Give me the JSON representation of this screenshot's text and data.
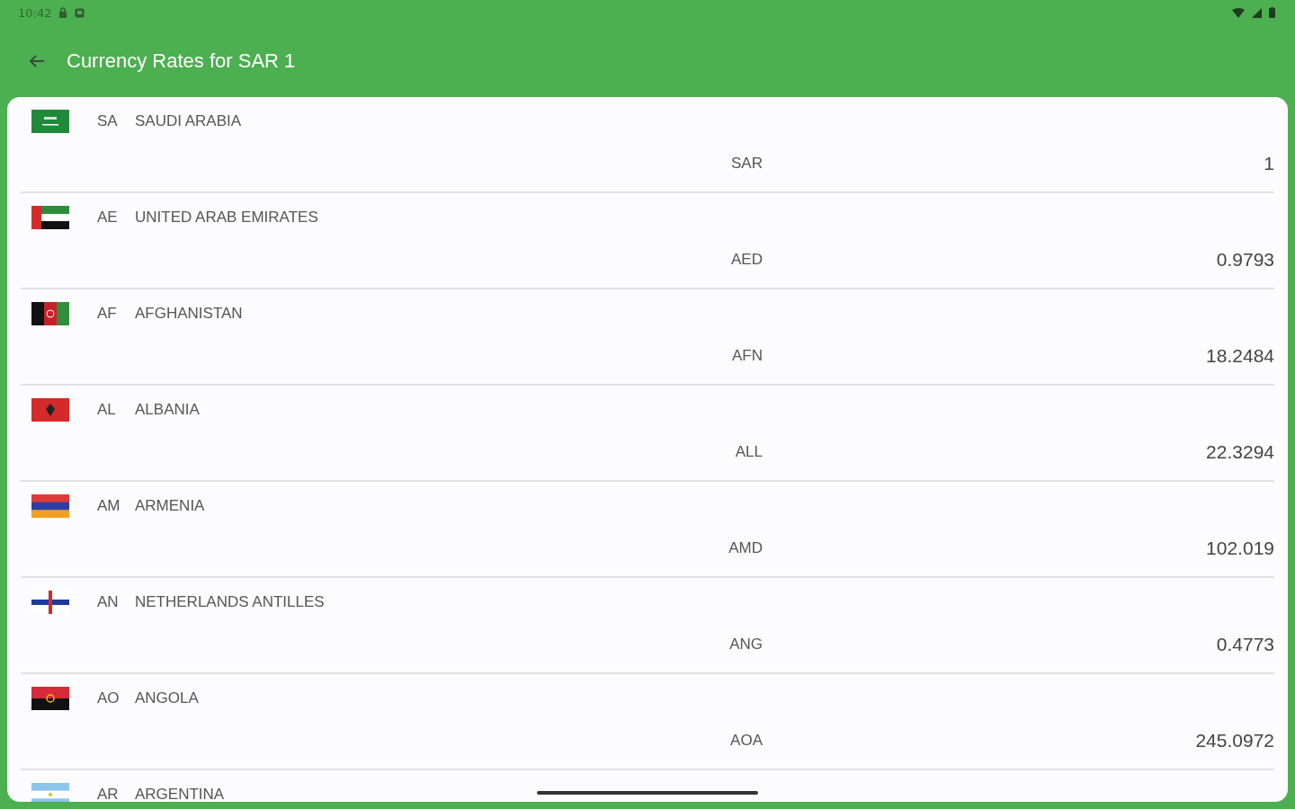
{
  "status_bar": {
    "time": "10:42"
  },
  "app_bar": {
    "title": "Currency Rates for SAR 1"
  },
  "rows": [
    {
      "kind": "saudi",
      "code": "SA",
      "country": "SAUDI ARABIA",
      "currency": "SAR",
      "rate": "1"
    },
    {
      "kind": "emirati",
      "code": "AE",
      "country": "UNITED ARAB EMIRATES",
      "currency": "AED",
      "rate": "0.9793"
    },
    {
      "kind": "afghan",
      "code": "AF",
      "country": "AFGHANISTAN",
      "currency": "AFN",
      "rate": "18.2484"
    },
    {
      "kind": "albanian",
      "code": "AL",
      "country": "ALBANIA",
      "currency": "ALL",
      "rate": "22.3294"
    },
    {
      "kind": "armenian",
      "code": "AM",
      "country": "ARMENIA",
      "currency": "AMD",
      "rate": "102.019"
    },
    {
      "kind": "antillean",
      "code": "AN",
      "country": "NETHERLANDS ANTILLES",
      "currency": "ANG",
      "rate": "0.4773"
    },
    {
      "kind": "angolan",
      "code": "AO",
      "country": "ANGOLA",
      "currency": "AOA",
      "rate": "245.0972"
    },
    {
      "kind": "argentine",
      "code": "AR",
      "country": "ARGENTINA"
    }
  ]
}
